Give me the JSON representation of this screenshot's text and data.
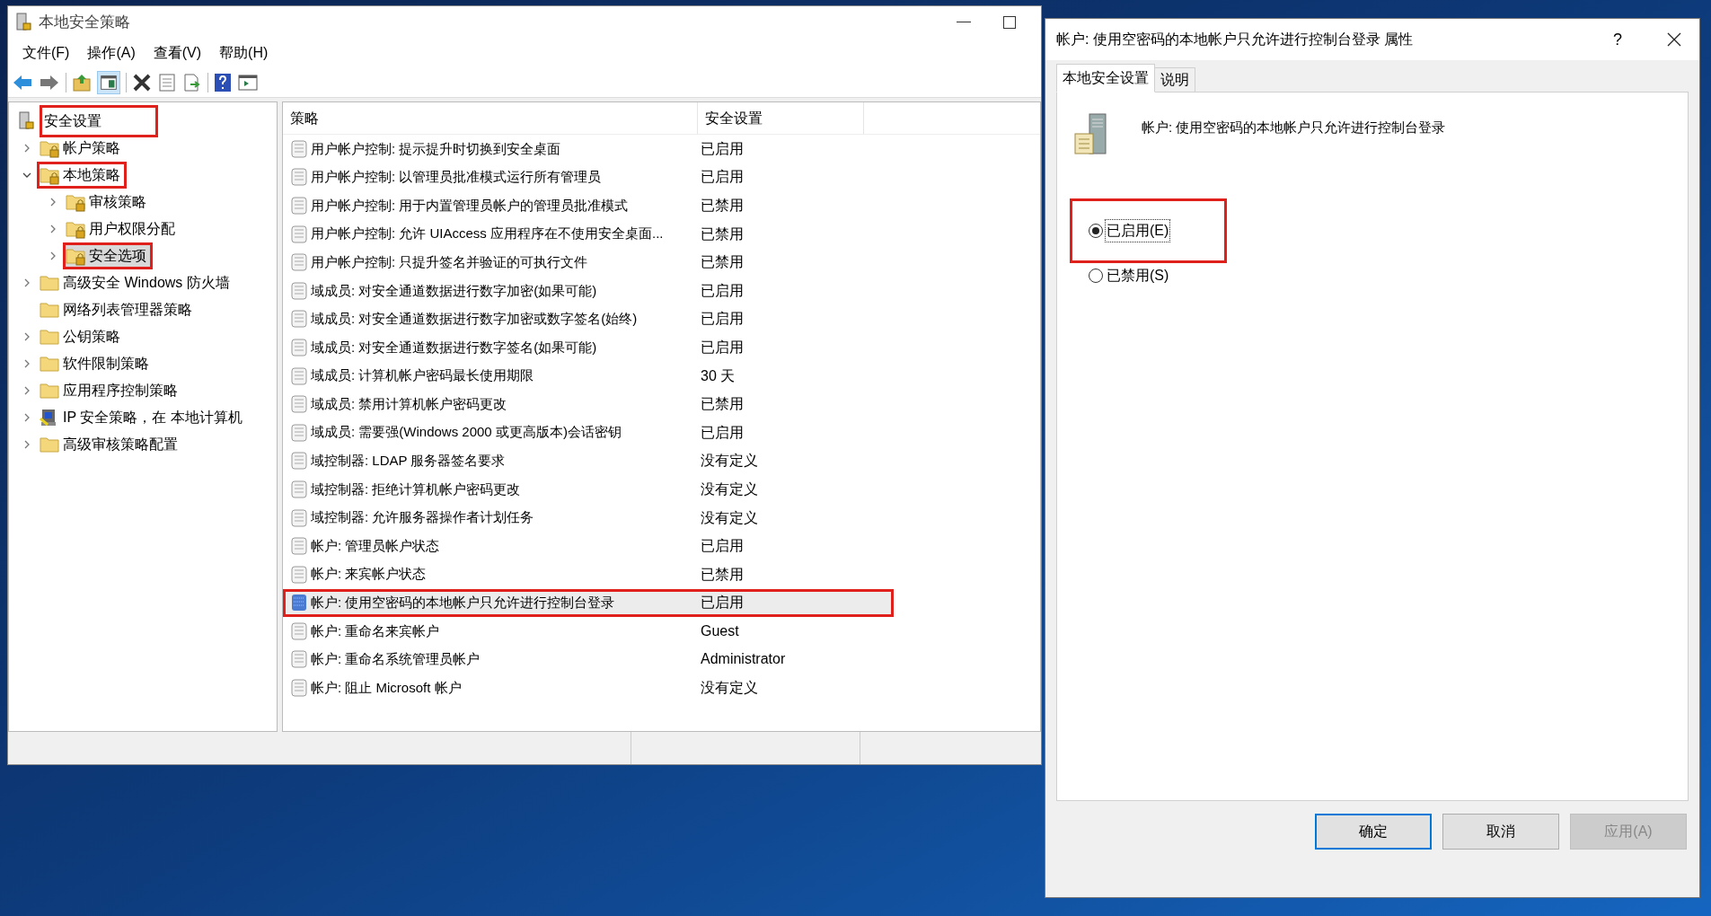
{
  "main_window": {
    "title": "本地安全策略",
    "menu": [
      "文件(F)",
      "操作(A)",
      "查看(V)",
      "帮助(H)"
    ]
  },
  "tree": {
    "root": {
      "label": "安全设置",
      "highlighted": true
    },
    "items": [
      {
        "label": "帐户策略",
        "kind": "lock-folder",
        "expandable": true,
        "expanded": false,
        "selected": false,
        "highlighted": false
      },
      {
        "label": "本地策略",
        "kind": "lock-folder",
        "expandable": true,
        "expanded": true,
        "selected": false,
        "highlighted": true,
        "children": [
          {
            "label": "审核策略",
            "kind": "lock-folder",
            "expandable": true,
            "expanded": false,
            "selected": false,
            "highlighted": false
          },
          {
            "label": "用户权限分配",
            "kind": "lock-folder",
            "expandable": true,
            "expanded": false,
            "selected": false,
            "highlighted": false
          },
          {
            "label": "安全选项",
            "kind": "lock-folder",
            "expandable": true,
            "expanded": false,
            "selected": true,
            "highlighted": true
          }
        ]
      },
      {
        "label": "高级安全 Windows 防火墙",
        "kind": "folder",
        "expandable": true,
        "expanded": false,
        "selected": false,
        "highlighted": false
      },
      {
        "label": "网络列表管理器策略",
        "kind": "folder",
        "expandable": false,
        "expanded": false,
        "selected": false,
        "highlighted": false
      },
      {
        "label": "公钥策略",
        "kind": "folder",
        "expandable": true,
        "expanded": false,
        "selected": false,
        "highlighted": false
      },
      {
        "label": "软件限制策略",
        "kind": "folder",
        "expandable": true,
        "expanded": false,
        "selected": false,
        "highlighted": false
      },
      {
        "label": "应用程序控制策略",
        "kind": "folder",
        "expandable": true,
        "expanded": false,
        "selected": false,
        "highlighted": false
      },
      {
        "label": "IP 安全策略，在 本地计算机",
        "kind": "ip-security",
        "expandable": true,
        "expanded": false,
        "selected": false,
        "highlighted": false
      },
      {
        "label": "高级审核策略配置",
        "kind": "folder",
        "expandable": true,
        "expanded": false,
        "selected": false,
        "highlighted": false
      }
    ]
  },
  "list": {
    "columns": [
      "策略",
      "安全设置"
    ],
    "rows": [
      {
        "policy": "用户帐户控制: 提示提升时切换到安全桌面",
        "setting": "已启用",
        "selected": false,
        "highlighted": false
      },
      {
        "policy": "用户帐户控制: 以管理员批准模式运行所有管理员",
        "setting": "已启用",
        "selected": false,
        "highlighted": false
      },
      {
        "policy": "用户帐户控制: 用于内置管理员帐户的管理员批准模式",
        "setting": "已禁用",
        "selected": false,
        "highlighted": false
      },
      {
        "policy": "用户帐户控制: 允许 UIAccess 应用程序在不使用安全桌面...",
        "setting": "已禁用",
        "selected": false,
        "highlighted": false
      },
      {
        "policy": "用户帐户控制: 只提升签名并验证的可执行文件",
        "setting": "已禁用",
        "selected": false,
        "highlighted": false
      },
      {
        "policy": "域成员: 对安全通道数据进行数字加密(如果可能)",
        "setting": "已启用",
        "selected": false,
        "highlighted": false
      },
      {
        "policy": "域成员: 对安全通道数据进行数字加密或数字签名(始终)",
        "setting": "已启用",
        "selected": false,
        "highlighted": false
      },
      {
        "policy": "域成员: 对安全通道数据进行数字签名(如果可能)",
        "setting": "已启用",
        "selected": false,
        "highlighted": false
      },
      {
        "policy": "域成员: 计算机帐户密码最长使用期限",
        "setting": "30 天",
        "selected": false,
        "highlighted": false
      },
      {
        "policy": "域成员: 禁用计算机帐户密码更改",
        "setting": "已禁用",
        "selected": false,
        "highlighted": false
      },
      {
        "policy": "域成员: 需要强(Windows 2000 或更高版本)会话密钥",
        "setting": "已启用",
        "selected": false,
        "highlighted": false
      },
      {
        "policy": "域控制器: LDAP 服务器签名要求",
        "setting": "没有定义",
        "selected": false,
        "highlighted": false
      },
      {
        "policy": "域控制器: 拒绝计算机帐户密码更改",
        "setting": "没有定义",
        "selected": false,
        "highlighted": false
      },
      {
        "policy": "域控制器: 允许服务器操作者计划任务",
        "setting": "没有定义",
        "selected": false,
        "highlighted": false
      },
      {
        "policy": "帐户: 管理员帐户状态",
        "setting": "已启用",
        "selected": false,
        "highlighted": false
      },
      {
        "policy": "帐户: 来宾帐户状态",
        "setting": "已禁用",
        "selected": false,
        "highlighted": false
      },
      {
        "policy": "帐户: 使用空密码的本地帐户只允许进行控制台登录",
        "setting": "已启用",
        "selected": true,
        "highlighted": true
      },
      {
        "policy": "帐户: 重命名来宾帐户",
        "setting": "Guest",
        "selected": false,
        "highlighted": false
      },
      {
        "policy": "帐户: 重命名系统管理员帐户",
        "setting": "Administrator",
        "selected": false,
        "highlighted": false
      },
      {
        "policy": "帐户: 阻止 Microsoft 帐户",
        "setting": "没有定义",
        "selected": false,
        "highlighted": false
      }
    ]
  },
  "dialog": {
    "title": "帐户: 使用空密码的本地帐户只允许进行控制台登录 属性",
    "help": "?",
    "tabs": [
      {
        "label": "本地安全设置",
        "selected": true
      },
      {
        "label": "说明",
        "selected": false
      }
    ],
    "policy_name": "帐户: 使用空密码的本地帐户只允许进行控制台登录",
    "options": [
      {
        "label": "已启用(E)",
        "checked": true,
        "focused": true,
        "highlighted": true
      },
      {
        "label": "已禁用(S)",
        "checked": false,
        "focused": false,
        "highlighted": false
      }
    ],
    "buttons": [
      {
        "label": "确定",
        "kind": "default",
        "disabled": false
      },
      {
        "label": "取消",
        "kind": "normal",
        "disabled": false
      },
      {
        "label": "应用(A)",
        "kind": "normal",
        "disabled": true
      }
    ]
  }
}
